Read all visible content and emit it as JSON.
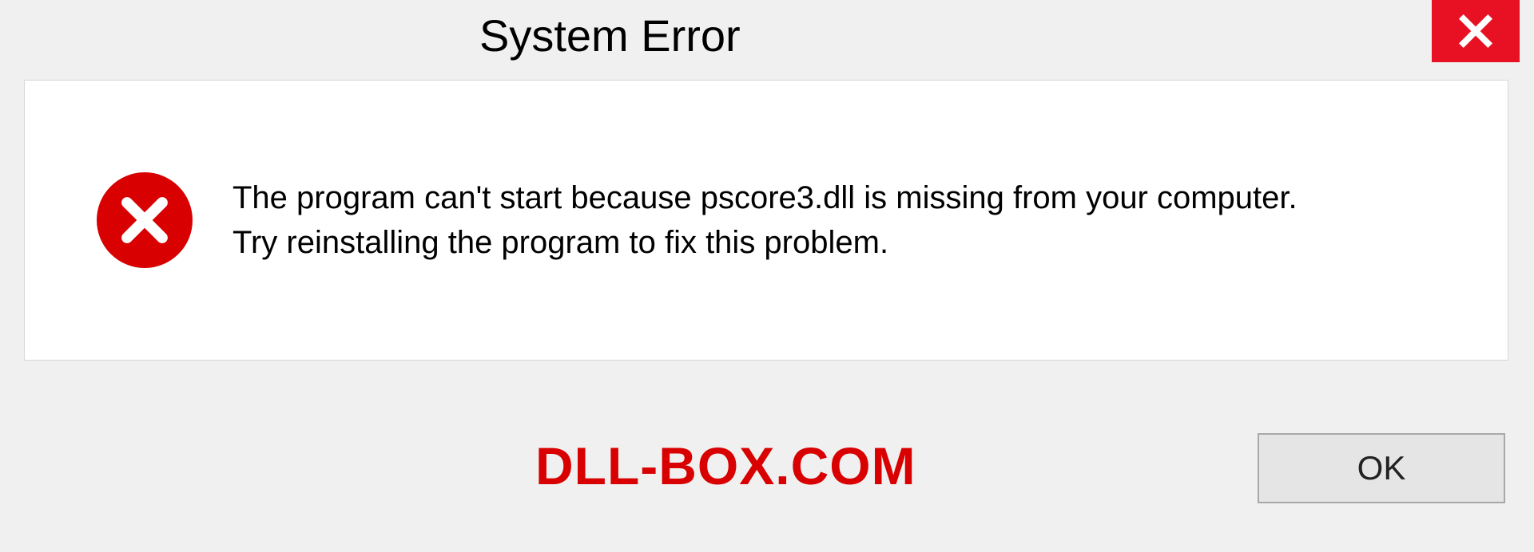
{
  "dialog": {
    "title": "System Error",
    "message_line1": "The program can't start because pscore3.dll is missing from your computer.",
    "message_line2": "Try reinstalling the program to fix this problem.",
    "ok_label": "OK"
  },
  "watermark": "DLL-BOX.COM"
}
